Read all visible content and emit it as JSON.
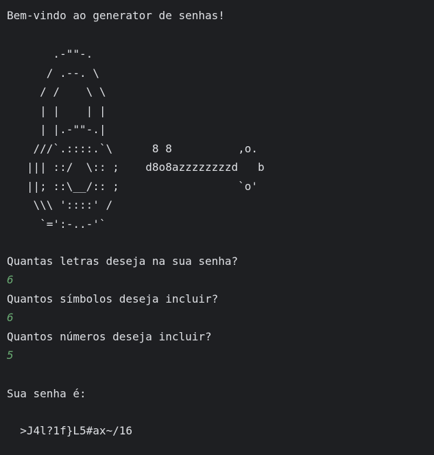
{
  "console": {
    "welcome": "Bem-vindo ao generator de senhas!",
    "ascii_art": [
      "       .-\"\"-.",
      "      / .--. \\",
      "     / /    \\ \\",
      "     | |    | |",
      "     | |.-\"\"-.|",
      "    ///`.::::.`\\      8 8          ,o.",
      "   ||| ::/  \\:: ;    d8o8azzzzzzzzd   b",
      "   ||; ::\\__/:: ;                  `o'",
      "    \\\\\\ '::::' /",
      "     `=':-..-'`"
    ],
    "prompt_letters": "Quantas letras deseja na sua senha?",
    "answer_letters": "6",
    "prompt_symbols": "Quantos símbolos deseja incluir?",
    "answer_symbols": "6",
    "prompt_numbers": "Quantos números deseja incluir?",
    "answer_numbers": "5",
    "result_label": "Sua senha é:",
    "password": "  >J4l?1f}L5#ax~/16"
  },
  "colors": {
    "background": "#1e1f22",
    "text": "#dfe1e5",
    "user_input": "#6aab73"
  }
}
